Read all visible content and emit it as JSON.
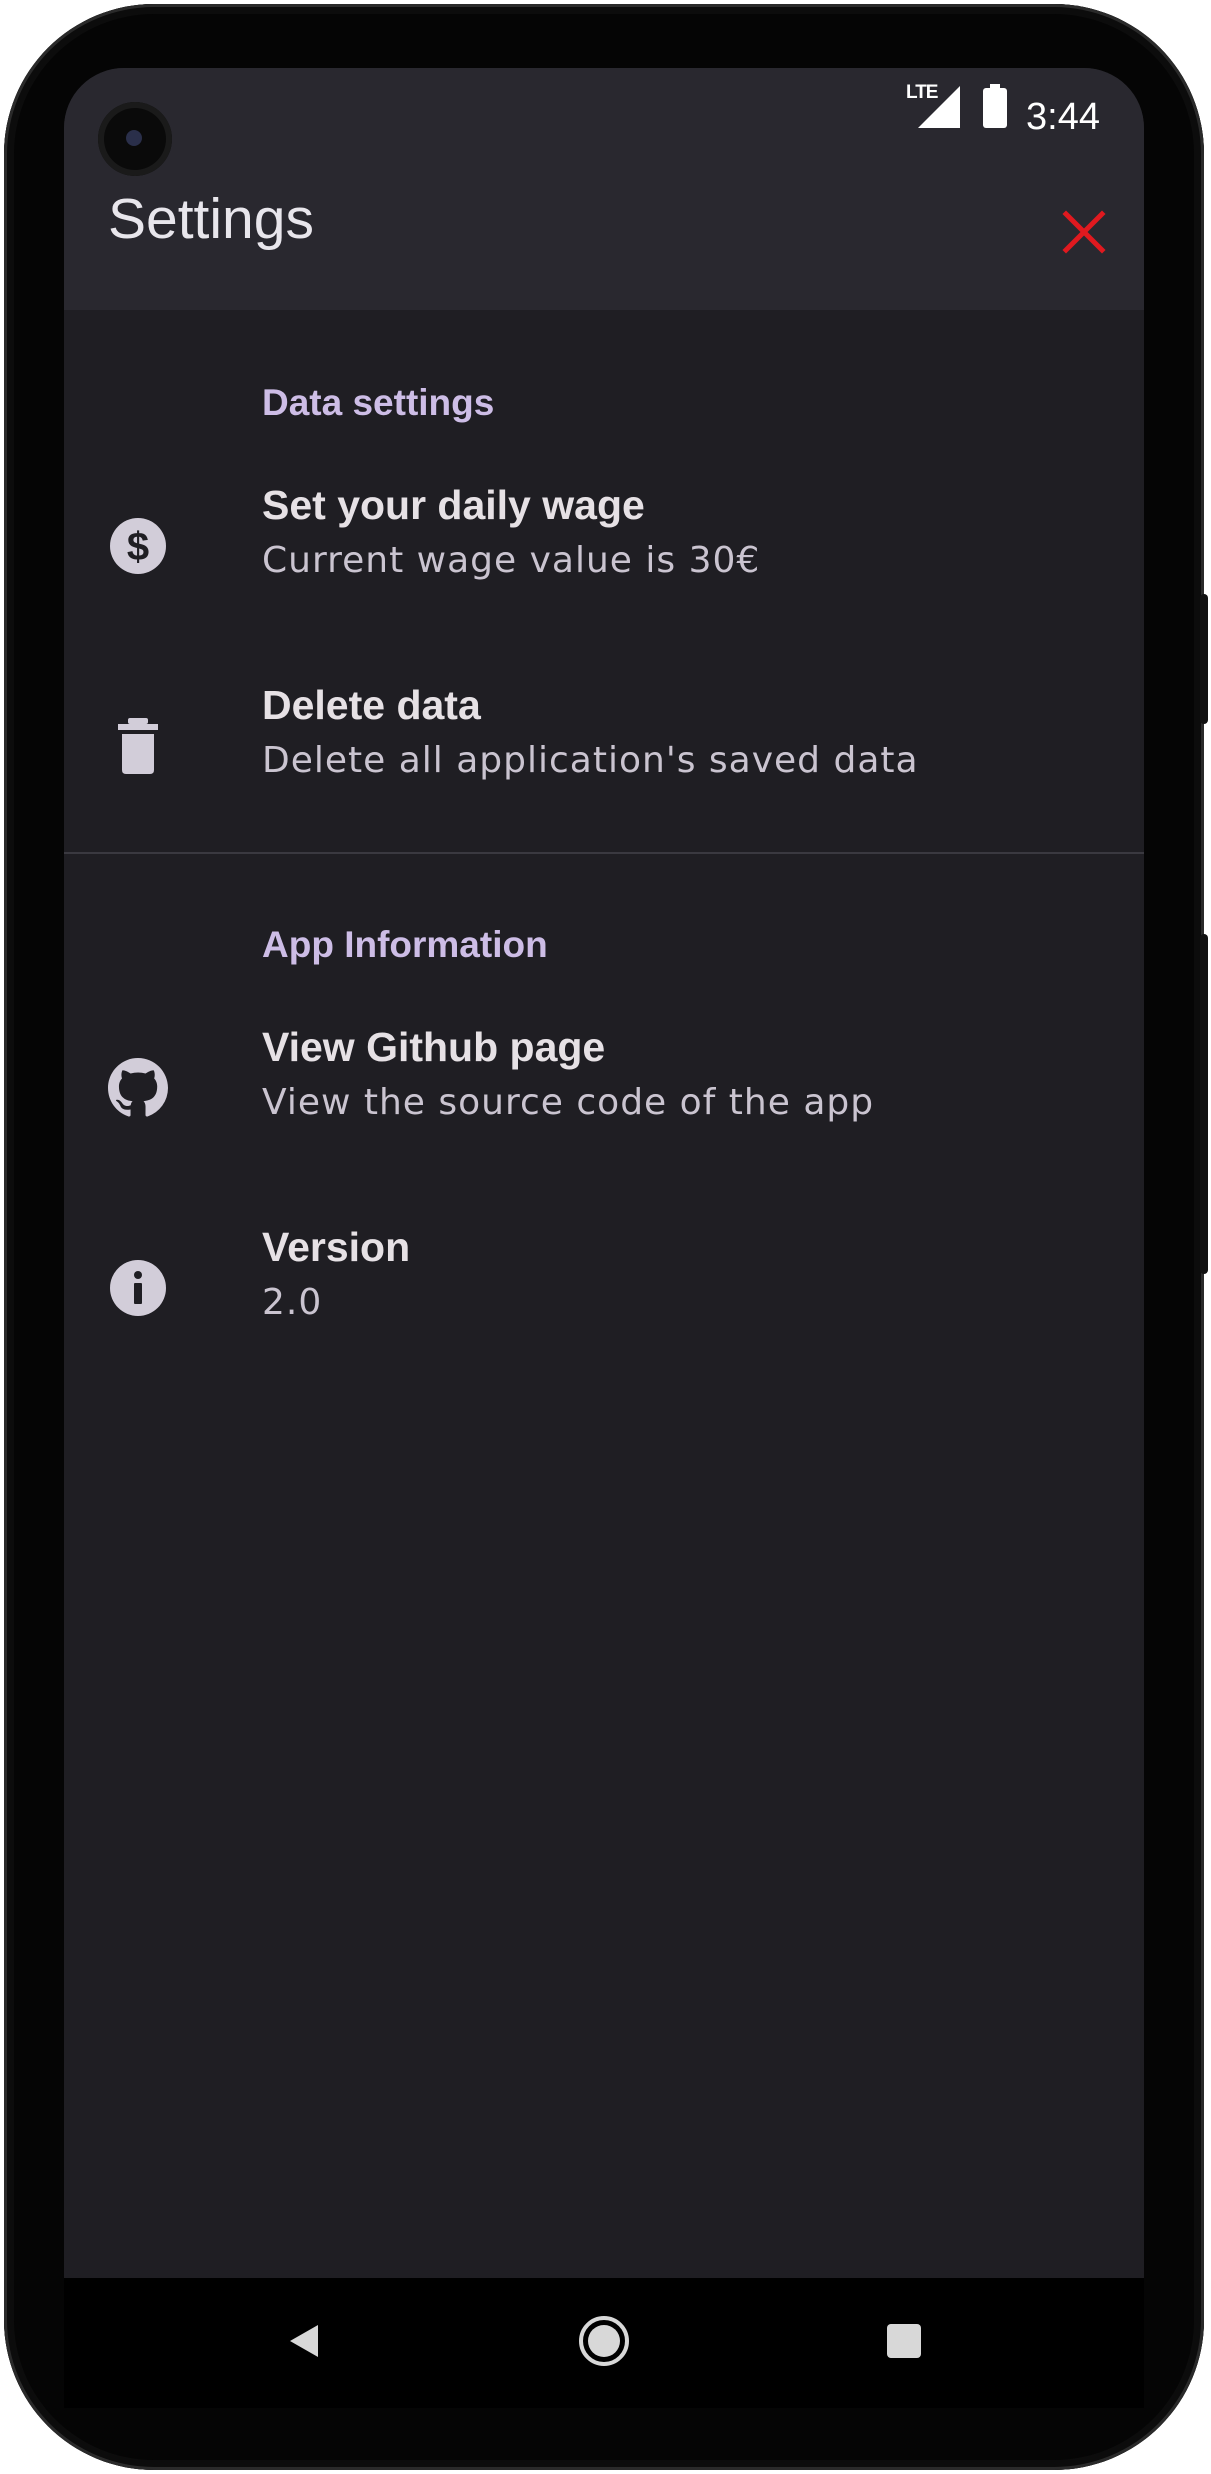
{
  "status_bar": {
    "network": "LTE",
    "time": "3:44",
    "signal_icon": "signal-icon",
    "battery_icon": "battery-icon"
  },
  "app_bar": {
    "title": "Settings",
    "close_icon": "close-icon",
    "close_color": "#e0191f"
  },
  "sections": [
    {
      "header": "Data settings",
      "items": [
        {
          "icon": "dollar-icon",
          "title": "Set your daily wage",
          "subtitle": "Current wage value is 30€"
        },
        {
          "icon": "trash-icon",
          "title": "Delete data",
          "subtitle": "Delete all application's saved data"
        }
      ]
    },
    {
      "header": "App Information",
      "items": [
        {
          "icon": "github-icon",
          "title": "View Github page",
          "subtitle": "View the source code of the app"
        },
        {
          "icon": "info-icon",
          "title": "Version",
          "subtitle": "2.0"
        }
      ]
    }
  ],
  "nav_bar": {
    "back_icon": "back-icon",
    "home_icon": "home-icon",
    "recents_icon": "recents-icon"
  },
  "colors": {
    "background": "#1f1e23",
    "app_bar": "#29282f",
    "section_header": "#cdbde6",
    "icon": "#d2cdd9"
  }
}
